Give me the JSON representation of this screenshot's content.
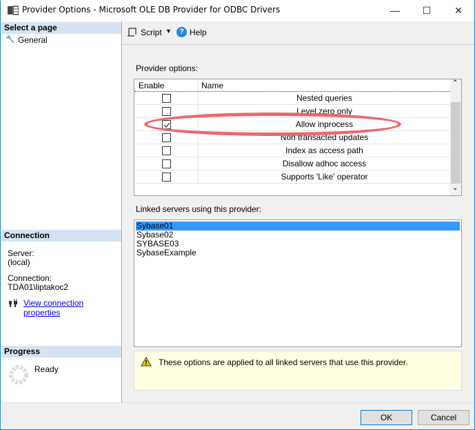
{
  "window": {
    "title": "Provider Options - Microsoft OLE DB Provider for ODBC Drivers",
    "minimize": "—",
    "maximize": "☐",
    "close": "✕"
  },
  "sidebar": {
    "select_page_header": "Select a page",
    "pages": [
      {
        "label": "General",
        "icon": "wrench-icon"
      }
    ],
    "connection_header": "Connection",
    "server_label": "Server:",
    "server_value": "(local)",
    "connection_label": "Connection:",
    "connection_value": "TDA01\\liptakoc2",
    "view_connection_link": "View connection properties",
    "progress_header": "Progress",
    "progress_status": "Ready"
  },
  "toolbar": {
    "script_label": "Script",
    "help_label": "Help"
  },
  "provider_options": {
    "label": "Provider options:",
    "columns": [
      "Enable",
      "Name"
    ],
    "rows": [
      {
        "name": "Nested queries",
        "enabled": false
      },
      {
        "name": "Level zero only",
        "enabled": false
      },
      {
        "name": "Allow inprocess",
        "enabled": true
      },
      {
        "name": "Non transacted updates",
        "enabled": false
      },
      {
        "name": "Index as access path",
        "enabled": false
      },
      {
        "name": "Disallow adhoc access",
        "enabled": false
      },
      {
        "name": "Supports 'Like' operator",
        "enabled": false
      }
    ]
  },
  "linked_servers": {
    "label": "Linked servers using this provider:",
    "items": [
      "Sybase01",
      "Sybase02",
      "SYBASE03",
      "SybaseExample"
    ],
    "selected": 0
  },
  "info": {
    "message": "These options are applied to all linked servers that use this provider."
  },
  "buttons": {
    "ok": "OK",
    "cancel": "Cancel"
  },
  "colors": {
    "selection": "#3399ff",
    "highlight_oval": "#ee6670",
    "link": "#0000ff"
  }
}
